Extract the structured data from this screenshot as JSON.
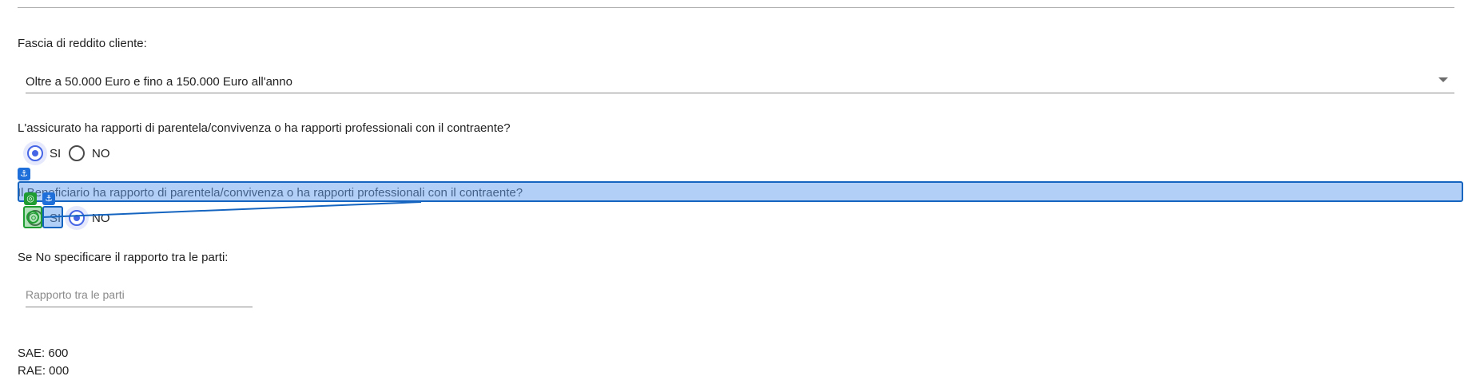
{
  "fields": {
    "income_label": "Fascia di reddito cliente:",
    "income_value": "Oltre a 50.000 Euro e fino a 150.000 Euro all'anno",
    "q1_label": "L'assicurato ha rapporti di parentela/convivenza o ha rapporti professionali con il contraente?",
    "q1_options": [
      {
        "label": "SI",
        "checked": true
      },
      {
        "label": "NO",
        "checked": false
      }
    ],
    "q2_label": "Il Beneficiario ha rapporto di parentela/convivenza o ha rapporti professionali con il contraente?",
    "q2_options": [
      {
        "label": "SI",
        "checked": false
      },
      {
        "label": "NO",
        "checked": true
      }
    ],
    "relation_label": "Se No specificare il rapporto tra le parti:",
    "relation_placeholder": "Rapporto tra le parti",
    "sae": "SAE: 600",
    "rae": "RAE: 000"
  },
  "icons": {
    "dropdown": "chevron-down-icon",
    "anchor": "anchor-icon",
    "target": "target-icon"
  },
  "overlay": {
    "anchor_glyph": "⚓",
    "target_glyph": "◎"
  },
  "colors": {
    "accent": "#4666e6",
    "overlay_blue": "#1565c0",
    "overlay_green": "#1f9d32"
  }
}
